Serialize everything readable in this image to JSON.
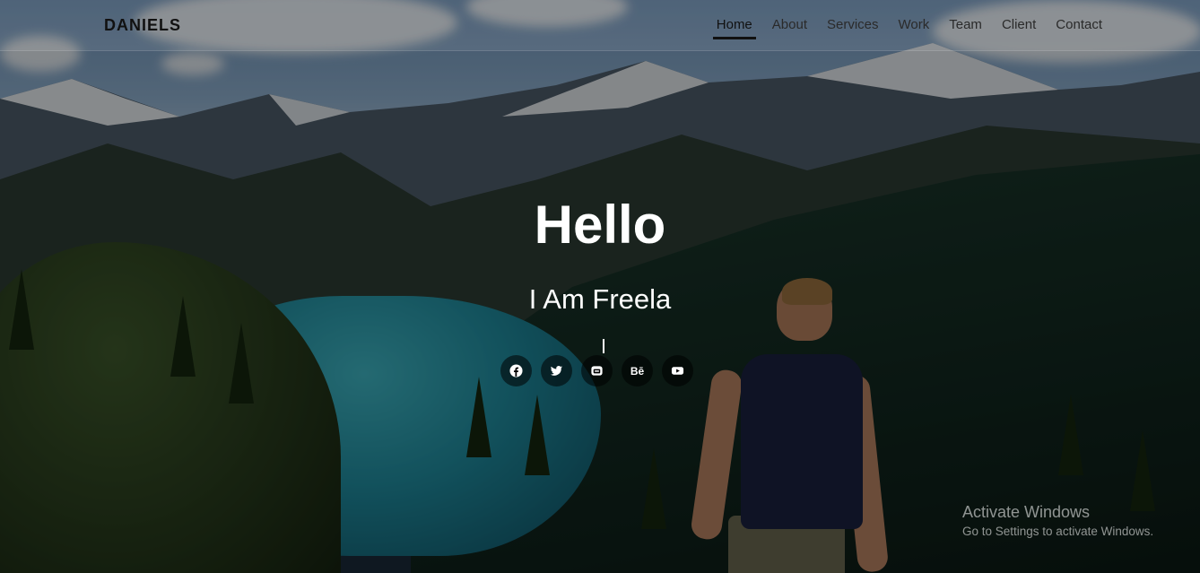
{
  "header": {
    "logo": "DANIELS"
  },
  "nav": {
    "items": [
      "Home",
      "About",
      "Services",
      "Work",
      "Team",
      "Client",
      "Contact"
    ],
    "active": "Home"
  },
  "hero": {
    "title": "Hello",
    "subtitle": "I Am Freela"
  },
  "socials": [
    "facebook-icon",
    "twitter-icon",
    "lock-icon",
    "behance-icon",
    "youtube-icon"
  ],
  "behance_label": "Bē",
  "watermark": {
    "title": "Activate Windows",
    "subtitle": "Go to Settings to activate Windows."
  }
}
